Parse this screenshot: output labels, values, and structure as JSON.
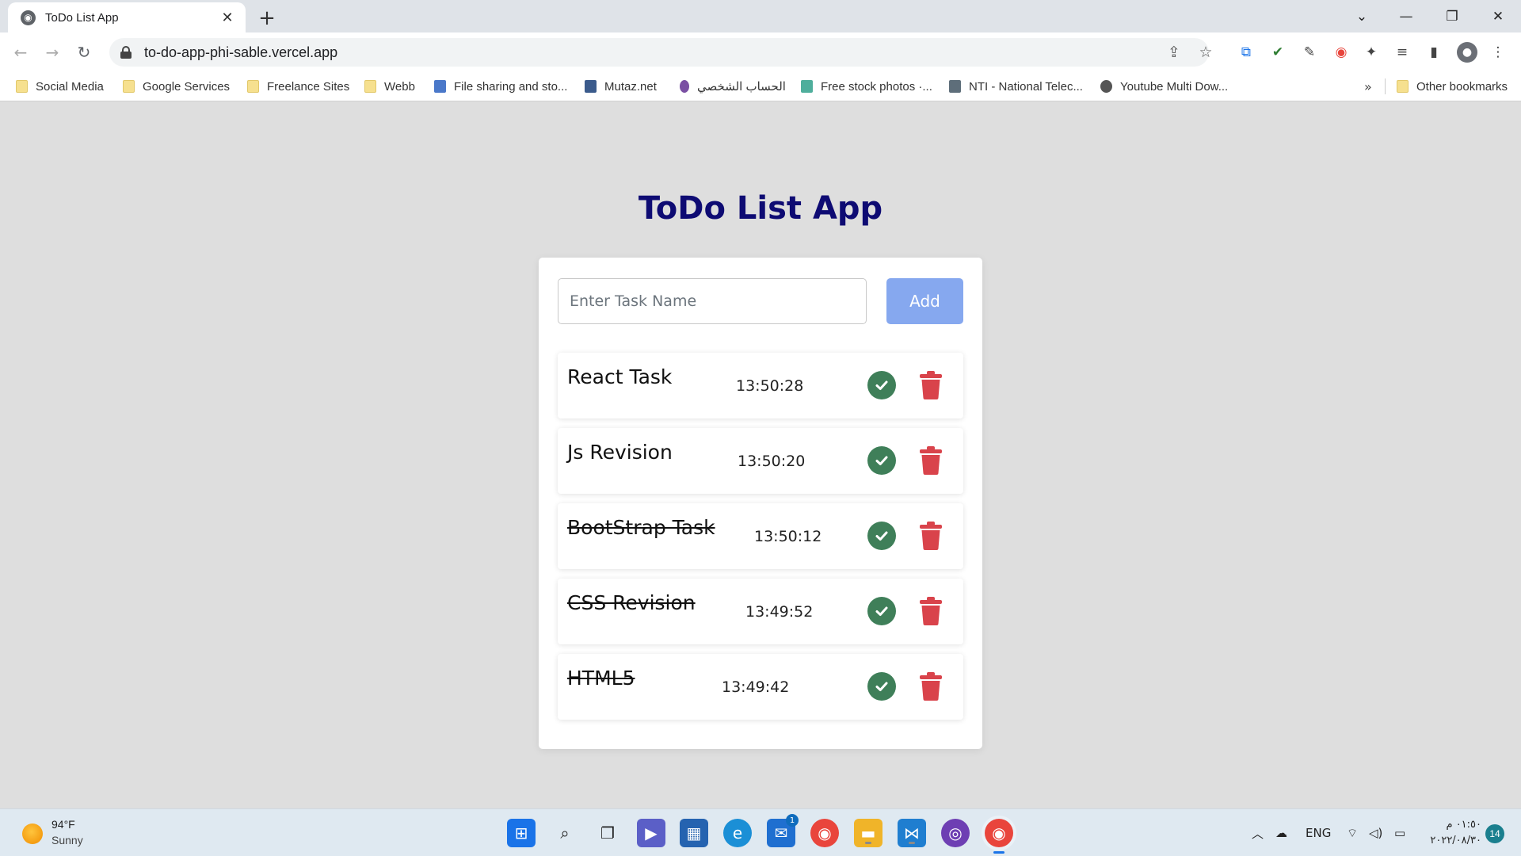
{
  "browser": {
    "tab_title": "ToDo List App",
    "tab_close": "✕",
    "new_tab": "+",
    "url": "to-do-app-phi-sable.vercel.app",
    "window_controls": {
      "chevron": "⌄",
      "minimize": "—",
      "restore": "❐",
      "close": "✕"
    },
    "nav": {
      "back": "←",
      "forward": "→",
      "reload": "↻"
    },
    "bookmarks": [
      {
        "label": "Social Media",
        "icon": "folder-icon"
      },
      {
        "label": "Google Services",
        "icon": "folder-icon"
      },
      {
        "label": "Freelance Sites",
        "icon": "folder-icon"
      },
      {
        "label": "Webb",
        "icon": "folder-icon"
      },
      {
        "label": "File sharing and sto...",
        "icon": "site-icon"
      },
      {
        "label": "Mutaz.net",
        "icon": "site-icon"
      },
      {
        "label": "الحساب الشخصي",
        "icon": "site-icon"
      },
      {
        "label": "Free stock photos ·...",
        "icon": "site-icon"
      },
      {
        "label": "NTI - National Telec...",
        "icon": "site-icon"
      },
      {
        "label": "Youtube Multi Dow...",
        "icon": "site-icon"
      }
    ],
    "bookmarks_more": "»",
    "other_bookmarks": "Other bookmarks"
  },
  "app": {
    "title": "ToDo List App",
    "input_placeholder": "Enter Task Name",
    "input_value": "",
    "add_label": "Add",
    "tasks": [
      {
        "name": "React Task",
        "time": "13:50:28",
        "completed": false
      },
      {
        "name": "Js Revision",
        "time": "13:50:20",
        "completed": false
      },
      {
        "name": "BootStrap Task",
        "time": "13:50:12",
        "completed": true
      },
      {
        "name": "CSS Revision",
        "time": "13:49:52",
        "completed": true
      },
      {
        "name": "HTML5",
        "time": "13:49:42",
        "completed": true
      }
    ],
    "colors": {
      "title": "#0e0b73",
      "add_button": "#86a8ef",
      "check": "#3f7f59",
      "trash": "#d9434b"
    }
  },
  "taskbar": {
    "weather_temp": "94°F",
    "weather_desc": "Sunny",
    "language": "ENG",
    "time": "٠١:٥٠ م",
    "date": "٢٠٢٢/٠٨/٣٠",
    "notifications": "14",
    "mail_badge": "1"
  }
}
